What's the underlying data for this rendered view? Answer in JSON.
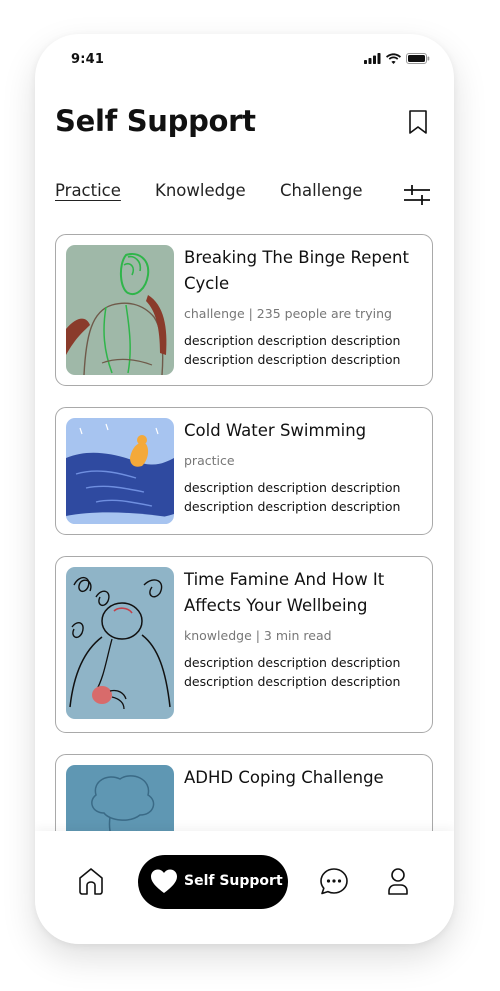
{
  "status_bar": {
    "time": "9:41",
    "icons": [
      "signal-icon",
      "wifi-icon",
      "battery-icon"
    ]
  },
  "header": {
    "title": "Self Support",
    "bookmark_icon": "bookmark-icon"
  },
  "tabs": [
    {
      "label": "Practice",
      "active": true
    },
    {
      "label": "Knowledge",
      "active": false
    },
    {
      "label": "Challenge",
      "active": false
    }
  ],
  "filter_icon": "sliders-icon",
  "cards": [
    {
      "title": "Breaking The Binge Repent Cycle",
      "meta": "challenge | 235 people are trying",
      "description": "description description description description description description"
    },
    {
      "title": "Cold Water Swimming",
      "meta": "practice",
      "description": "description description description description description description"
    },
    {
      "title": "Time Famine And How It Affects Your Wellbeing",
      "meta": "knowledge | 3 min read",
      "description": "description description description description description description"
    },
    {
      "title": "ADHD Coping Challenge",
      "meta": "",
      "description": ""
    }
  ],
  "bottom_nav": {
    "home_icon": "home-icon",
    "active_label": "Self Support",
    "active_icon": "heart-icon",
    "chat_icon": "chat-icon",
    "profile_icon": "user-icon"
  },
  "colors": {
    "accent": "#000000",
    "card_border": "#a9a9a9",
    "meta_text": "#777777",
    "thumb_sage": "#9fb8a8",
    "thumb_blue": "#2f4aa0",
    "thumb_sky": "#8fb4c7",
    "thumb_teal": "#5f97b3"
  }
}
